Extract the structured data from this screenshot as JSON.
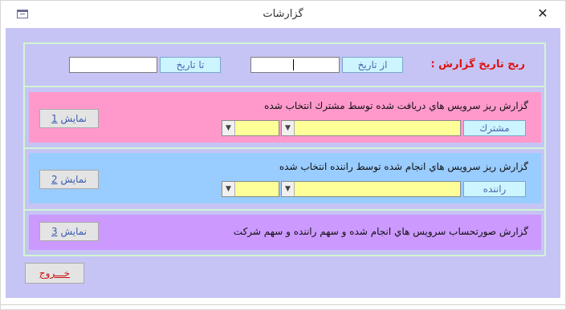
{
  "window": {
    "title": "گزارشات",
    "close_glyph": "✕"
  },
  "date_range": {
    "label": "ربج تاريخ گزارش :",
    "from_label": "از تاريخ",
    "from_value": "",
    "to_label": "تا تاريخ",
    "to_value": ""
  },
  "reports": [
    {
      "title": "گزارش ريز سرويس هاي دريافت شده توسط مشترك انتخاب شده",
      "field_label": "مشترك",
      "button_text": "نمايش ",
      "button_number": "1",
      "color": "#ff99cc"
    },
    {
      "title": "گزارش ريز سرويس هاي انجام شده توسط راننده انتخاب شده",
      "field_label": "راننده",
      "button_text": "نمايش ",
      "button_number": "2",
      "color": "#99ccff"
    },
    {
      "title": "گزارش صورتحساب سرويس هاي انجام شده و سهم راننده و سهم شركت",
      "button_text": "نمايش ",
      "button_number": "3",
      "color": "#cc99ff"
    }
  ],
  "exit": {
    "label": "خـــروج"
  },
  "colors": {
    "form_background": "#c6c4f5",
    "frame_border": "#d2f5d2",
    "combo_fill": "#ffff99",
    "label_fill": "#ccf5ff",
    "accent_red": "#e01010"
  },
  "icons": {
    "window": "form-icon",
    "close": "close-icon",
    "dropdown": "chevron-down-icon"
  }
}
